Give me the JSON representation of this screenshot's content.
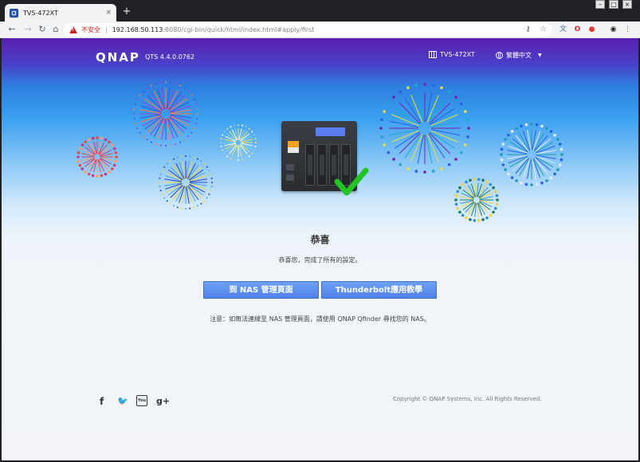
{
  "browser": {
    "tab_title": "TVS-472XT",
    "tab_close": "×",
    "new_tab": "+",
    "insecure_label": "不安全",
    "separator": "|",
    "url_host": "192.168.50.113",
    "url_path": ":8080/cgi-bin/quick/html/index.html#apply/first",
    "win_minimize": "–",
    "win_maximize": "□",
    "win_close": "×"
  },
  "header": {
    "logo": "QNAP",
    "version": "QTS 4.4.0.0762",
    "device_name": "TVS-472XT",
    "language": "繁體中文"
  },
  "main": {
    "title": "恭喜",
    "subtitle": "恭喜您，完成了所有的設定。",
    "nas_button_label": "到 NAS 管理頁面",
    "thunderbolt_button_label": "Thunderbolt應用教學",
    "note": "注意：如無法連線至 NAS 管理頁面，請使用 QNAP Qfinder 尋找您的 NAS。"
  },
  "footer": {
    "facebook": "f",
    "twitter": "🐦",
    "youtube": "You",
    "googleplus": "g+",
    "copyright": "Copyright © QNAP Systems, Inc. All Rights Reserved."
  },
  "colors": {
    "header_purple": "#5a1fb0",
    "button_blue": "#5a8ef0",
    "check_green": "#22c422"
  }
}
